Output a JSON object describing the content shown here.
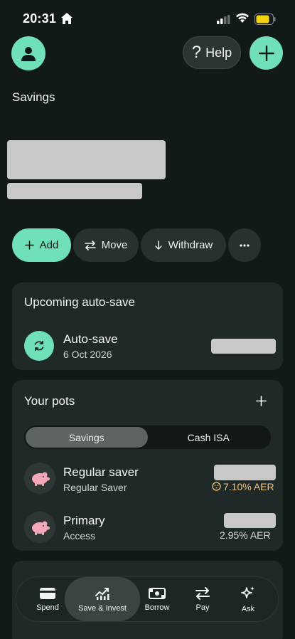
{
  "status_bar": {
    "time": "20:31"
  },
  "header": {
    "help_label": "Help"
  },
  "page": {
    "title": "Savings"
  },
  "actions": {
    "add": "Add",
    "move": "Move",
    "withdraw": "Withdraw"
  },
  "upcoming": {
    "title": "Upcoming auto-save",
    "item_title": "Auto-save",
    "item_date": "6 Oct 2026"
  },
  "pots": {
    "title": "Your pots",
    "tabs": [
      "Savings",
      "Cash ISA"
    ],
    "items": [
      {
        "name": "Regular saver",
        "type": "Regular Saver",
        "rate": "7.10% AER"
      },
      {
        "name": "Primary",
        "type": "Access",
        "rate": "2.95% AER"
      }
    ]
  },
  "nav": {
    "items": [
      "Spend",
      "Save & Invest",
      "Borrow",
      "Pay",
      "Ask"
    ],
    "active": "Save & Invest"
  },
  "colors": {
    "background": "#111a18",
    "accent": "#6fe0b7",
    "card": "#1f2927",
    "pig": "#f4a7b9",
    "bonus_rate": "#f1c680"
  }
}
